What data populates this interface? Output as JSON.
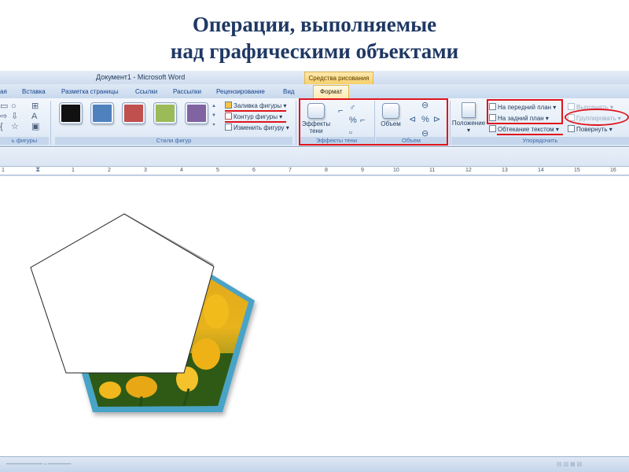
{
  "slide": {
    "title_line1": "Операции, выполняемые",
    "title_line2": "над графическими объектами",
    "title_color": "#1f3864"
  },
  "window": {
    "doc_title": "Документ1 - Microsoft Word",
    "context_tab_header": "Средства рисования"
  },
  "tabs": [
    {
      "label": "ая"
    },
    {
      "label": "Вставка"
    },
    {
      "label": "Разметка страницы"
    },
    {
      "label": "Ссылки"
    },
    {
      "label": "Рассылки"
    },
    {
      "label": "Рецензирование"
    },
    {
      "label": "Вид"
    },
    {
      "label": "Формат",
      "active": true
    }
  ],
  "ribbon": {
    "groups": {
      "insert_shapes": "ь фигуры",
      "shape_styles": "Стили фигур",
      "shadow_effects": "Эффекты тени",
      "effects_3d": "Объем",
      "arrange": "Упорядочить"
    },
    "swatches": [
      {
        "name": "black",
        "color": "#111111"
      },
      {
        "name": "blue",
        "color": "#4f81bd"
      },
      {
        "name": "red",
        "color": "#c0504d"
      },
      {
        "name": "green",
        "color": "#9bbb59"
      },
      {
        "name": "purple",
        "color": "#8064a2"
      }
    ],
    "style_commands": {
      "fill": "Заливка фигуры",
      "outline": "Контур фигуры",
      "change": "Изменить фигуру"
    },
    "shadow": {
      "label_line1": "Эффекты",
      "label_line2": "тени"
    },
    "volume": {
      "label": "Объем"
    },
    "arrange": {
      "position": "Положение",
      "bring_front": "На передний план",
      "send_back": "На задний план",
      "wrap_text": "Обтекание текстом",
      "align": "Выровнять",
      "group": "Группировать",
      "rotate": "Повернуть"
    }
  },
  "ruler": {
    "marks": [
      "1",
      "1",
      "2",
      "3",
      "4",
      "5",
      "6",
      "7",
      "8",
      "9",
      "10",
      "11",
      "12",
      "13",
      "14",
      "15",
      "16"
    ]
  },
  "highlight_color": "#e0141c"
}
